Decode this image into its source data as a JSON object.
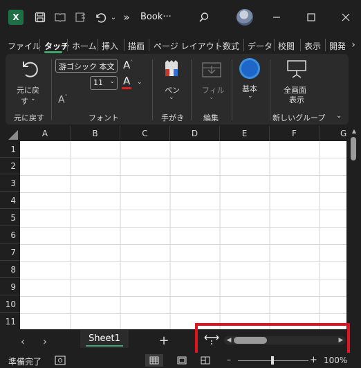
{
  "titlebar": {
    "app_logo": "X",
    "filename": "Book···",
    "icons": [
      "save-icon",
      "cloud-icon",
      "touch-mode-icon",
      "undo-icon",
      "more-icon",
      "search-icon",
      "minimize-icon",
      "maximize-icon",
      "close-icon"
    ],
    "more_glyph": "»"
  },
  "tabs": [
    "ファイル",
    "タッチ",
    "ホーム",
    "挿入",
    "描画",
    "ページ レイアウト",
    "数式",
    "データ",
    "校閲",
    "表示",
    "開発"
  ],
  "active_tab": "タッチ",
  "ribbon": {
    "undo_label_1": "元に戻",
    "undo_label_2": "す",
    "font_name": "游ゴシック 本文",
    "font_size": "11",
    "pen_label": "ペン",
    "fill_label": "フィル",
    "basic_label": "基本",
    "fullscreen_label_1": "全画面",
    "fullscreen_label_2": "表示",
    "groups": [
      "元に戻す",
      "フォント",
      "手がき",
      "編集",
      "新しいグループ"
    ]
  },
  "grid": {
    "columns": [
      "A",
      "B",
      "C",
      "D",
      "E",
      "F",
      "G"
    ],
    "rows": [
      "1",
      "2",
      "3",
      "4",
      "5",
      "6",
      "7",
      "8",
      "9",
      "10",
      "11"
    ]
  },
  "sheets": {
    "tabs": [
      "Sheet1"
    ],
    "add_glyph": "+"
  },
  "status": {
    "ready": "準備完了",
    "zoom": "100%",
    "zoom_minus": "–",
    "zoom_plus": "+",
    "zoom_level": 0.5
  },
  "colors": {
    "accent": "#3fa56b",
    "highlight_box": "#e0141e",
    "font_color_bar": "#e02020"
  }
}
